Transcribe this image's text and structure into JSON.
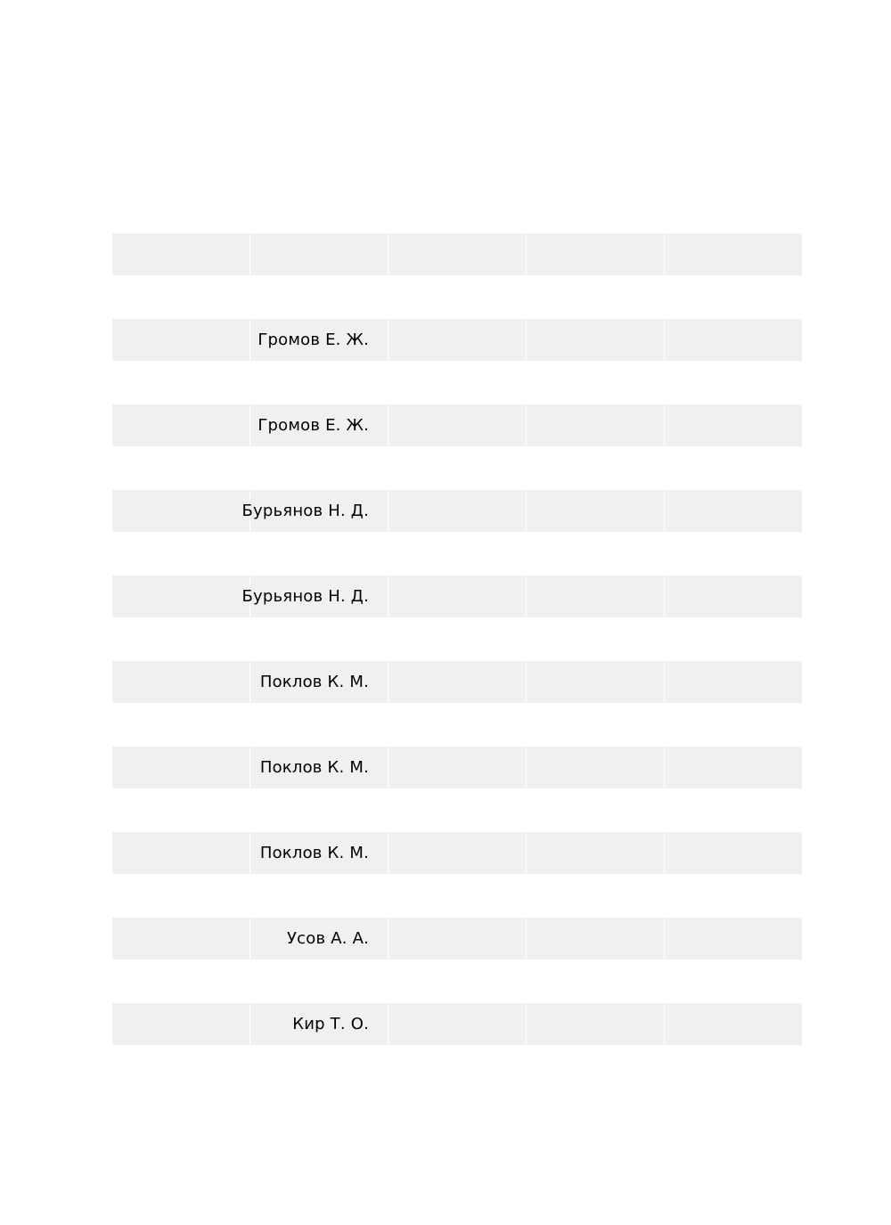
{
  "table": {
    "rows": [
      {
        "name": ""
      },
      {
        "name": "Громов Е. Ж."
      },
      {
        "name": "Громов Е. Ж."
      },
      {
        "name": "Бурьянов Н. Д."
      },
      {
        "name": "Бурьянов Н. Д."
      },
      {
        "name": "Поклов К. М."
      },
      {
        "name": "Поклов К. М."
      },
      {
        "name": "Поклов К. М."
      },
      {
        "name": "Усов А. А."
      },
      {
        "name": "Кир Т. О."
      }
    ]
  }
}
